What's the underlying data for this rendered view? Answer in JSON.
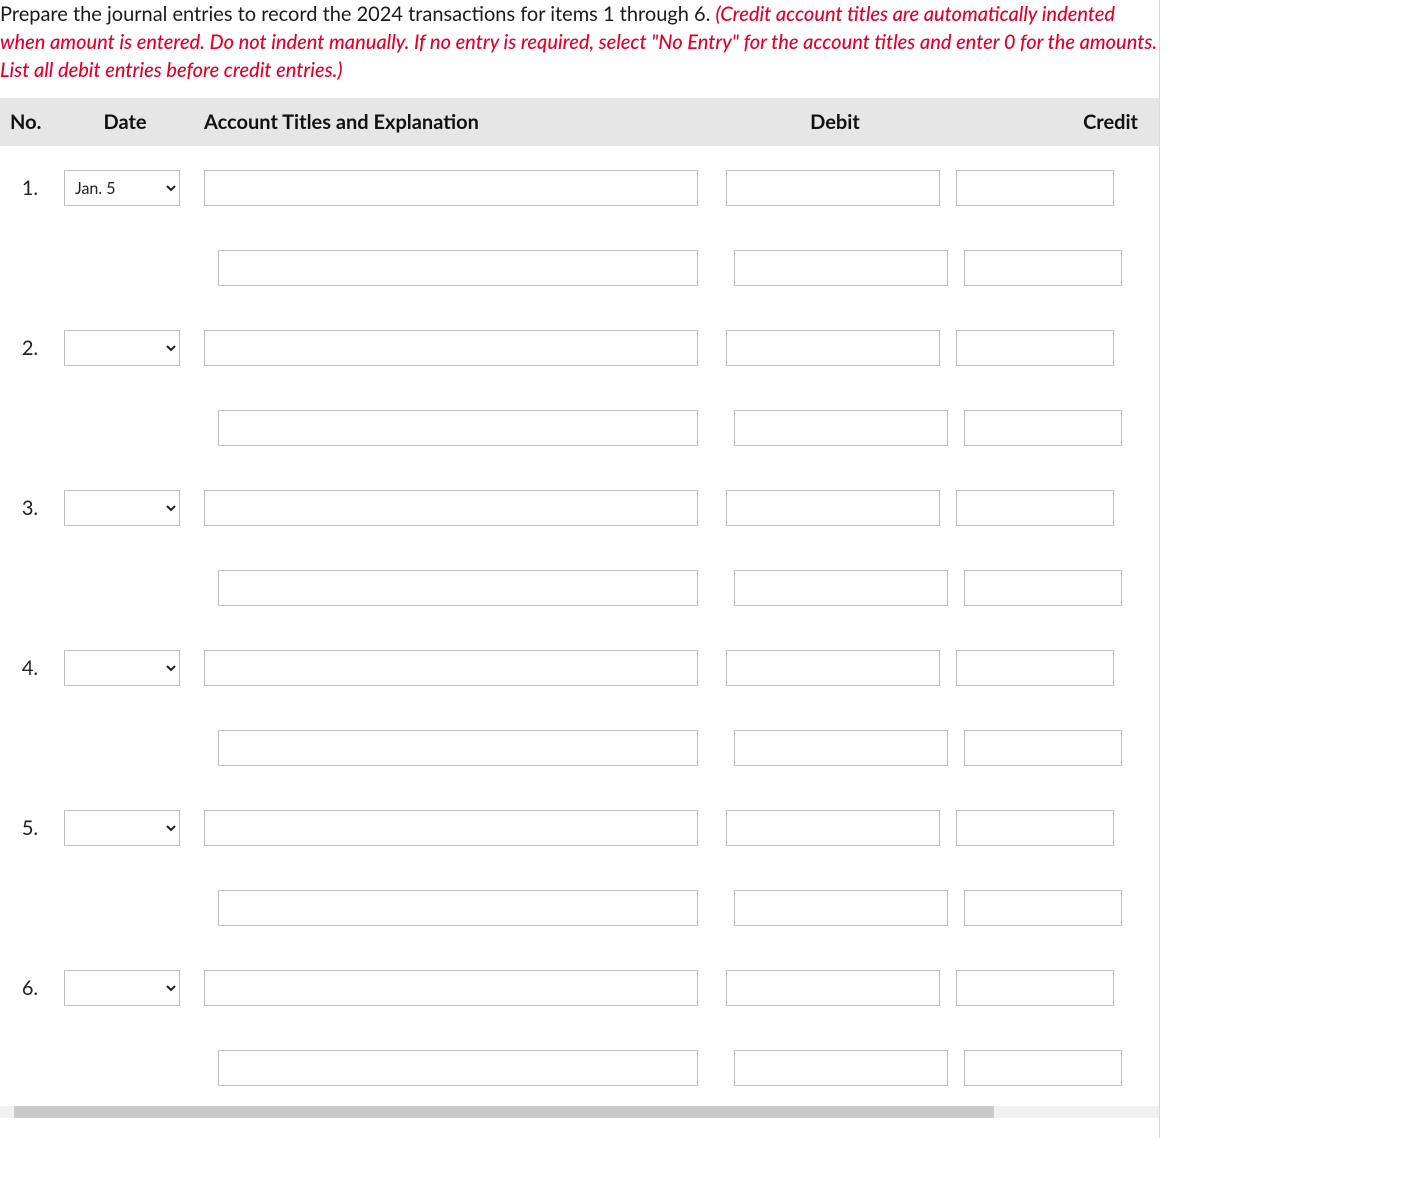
{
  "instructions": {
    "black": "Prepare the journal entries to record the 2024 transactions for items 1 through 6. ",
    "red": "(Credit account titles are automatically indented when amount is entered. Do not indent manually. If no entry is required, select \"No Entry\" for the account titles and enter 0 for the amounts. List all debit entries before credit entries.)"
  },
  "headers": {
    "no": "No.",
    "date": "Date",
    "account": "Account Titles and Explanation",
    "debit": "Debit",
    "credit": "Credit"
  },
  "entries": [
    {
      "no": "1.",
      "date": "Jan. 5",
      "lines": [
        {
          "acct": "",
          "debit": "",
          "credit": ""
        },
        {
          "acct": "",
          "debit": "",
          "credit": ""
        }
      ]
    },
    {
      "no": "2.",
      "date": "",
      "lines": [
        {
          "acct": "",
          "debit": "",
          "credit": ""
        },
        {
          "acct": "",
          "debit": "",
          "credit": ""
        }
      ]
    },
    {
      "no": "3.",
      "date": "",
      "lines": [
        {
          "acct": "",
          "debit": "",
          "credit": ""
        },
        {
          "acct": "",
          "debit": "",
          "credit": ""
        }
      ]
    },
    {
      "no": "4.",
      "date": "",
      "lines": [
        {
          "acct": "",
          "debit": "",
          "credit": ""
        },
        {
          "acct": "",
          "debit": "",
          "credit": ""
        }
      ]
    },
    {
      "no": "5.",
      "date": "",
      "lines": [
        {
          "acct": "",
          "debit": "",
          "credit": ""
        },
        {
          "acct": "",
          "debit": "",
          "credit": ""
        }
      ]
    },
    {
      "no": "6.",
      "date": "",
      "lines": [
        {
          "acct": "",
          "debit": "",
          "credit": ""
        },
        {
          "acct": "",
          "debit": "",
          "credit": ""
        }
      ]
    }
  ]
}
